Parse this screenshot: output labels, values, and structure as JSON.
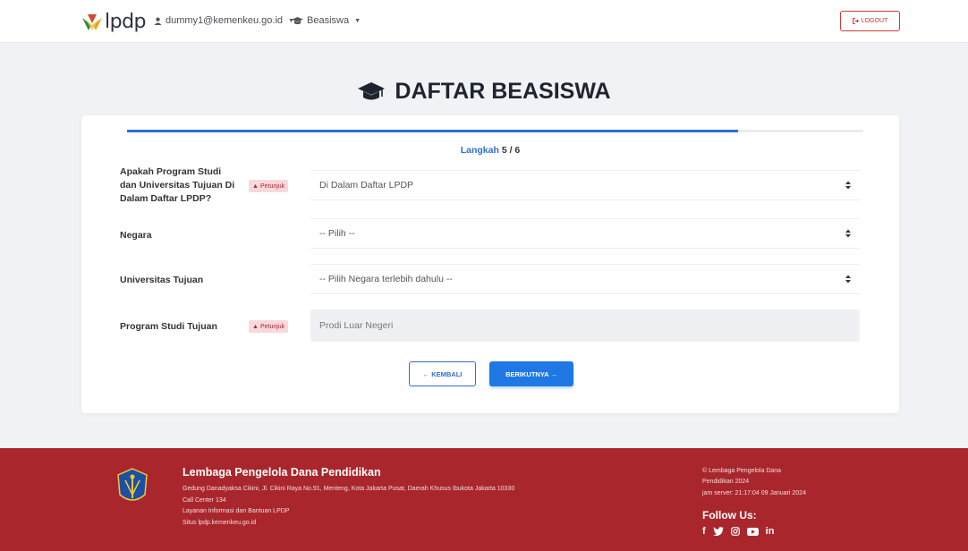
{
  "navbar": {
    "logo_text": "lpdp",
    "user_email": "dummy1@kemenkeu.go.id",
    "menu_beasiswa": "Beasiswa",
    "logout_label": "LOGOUT"
  },
  "page": {
    "title": "DAFTAR BEASISWA"
  },
  "progress": {
    "step_word": "Langkah",
    "step_value": "5 / 6",
    "fraction": 0.83
  },
  "form": {
    "q1_label": "Apakah Program Studi dan Universitas Tujuan Di Dalam Daftar LPDP?",
    "q1_badge": "Petunjuk",
    "q1_value": "Di Dalam Daftar LPDP",
    "country_label": "Negara",
    "country_value": "-- Pilih --",
    "university_label": "Universitas Tujuan",
    "university_value": "-- Pilih Negara terlebih dahulu --",
    "program_label": "Program Studi Tujuan",
    "program_badge": "Petunjuk",
    "program_value": "Prodi Luar Negeri"
  },
  "buttons": {
    "back": "← KEMBALI",
    "next": "BERIKUTNYA →"
  },
  "footer": {
    "org_name": "Lembaga Pengelola Dana Pendidikan",
    "address": "Gedung Danadyaksa Cikini, Jl. Cikini Raya No.91, Menteng, Kota Jakarta Pusat, Daerah Khusus Ibukota Jakarta 10330",
    "call_center": "Call Center 134",
    "info_service": "Layanan Informasi dan Bantuan LPDP",
    "site": "Situs lpdp.kemenkeu.go.id",
    "copyright_1": "© Lembaga Pengelola Dana",
    "copyright_2": "Pendidikan 2024",
    "server_time": "jam server: 21:17:04 09 Januari 2024",
    "follow_us": "Follow Us:",
    "socials": [
      "facebook-icon",
      "twitter-icon",
      "instagram-icon",
      "youtube-icon",
      "linkedin-icon"
    ]
  },
  "colors": {
    "primary": "#1f78e3",
    "footer_bg": "#a9262d",
    "logout": "#c73030",
    "badge_bg": "#f7d9dc"
  }
}
